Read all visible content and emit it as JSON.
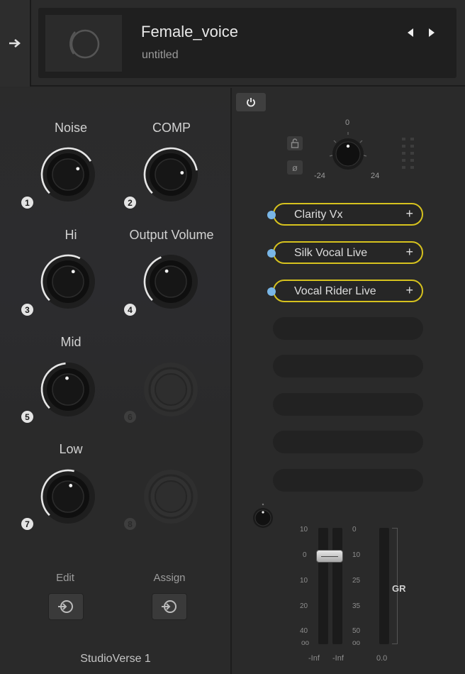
{
  "header": {
    "preset_name": "Female_voice",
    "preset_subtitle": "untitled",
    "side_icon": "arrow-right-icon",
    "prev_icon": "triangle-left-icon",
    "next_icon": "triangle-right-icon"
  },
  "macros": {
    "knobs": [
      {
        "label": "Noise",
        "number": "1",
        "value": 0.72
      },
      {
        "label": "COMP",
        "number": "2",
        "value": 0.8
      },
      {
        "label": "Hi",
        "number": "3",
        "value": 0.6
      },
      {
        "label": "Output Volume",
        "number": "4",
        "value": 0.42
      },
      {
        "label": "Mid",
        "number": "5",
        "value": 0.48
      },
      {
        "label": "",
        "number": "6",
        "value": null
      },
      {
        "label": "Low",
        "number": "7",
        "value": 0.55
      },
      {
        "label": "",
        "number": "8",
        "value": null
      }
    ],
    "edit_label": "Edit",
    "assign_label": "Assign",
    "footer": "StudioVerse 1"
  },
  "fx": {
    "gain_scale": {
      "center": "0",
      "min": "-24",
      "max": "24"
    },
    "plugins": [
      {
        "name": "Clarity Vx",
        "plus": "+"
      },
      {
        "name": "Silk Vocal Live",
        "plus": "+"
      },
      {
        "name": "Vocal Rider Live",
        "plus": "+"
      }
    ],
    "empty_slots": 5,
    "meter": {
      "left_scale": [
        "10",
        "0",
        "10",
        "20",
        "40",
        "oo"
      ],
      "right_scale": [
        "0",
        "10",
        "25",
        "35",
        "50",
        "oo"
      ],
      "bottom_left": "-Inf",
      "bottom_mid": "-Inf",
      "bottom_gr": "0.0",
      "gr_label": "GR"
    }
  },
  "colors": {
    "accent_yellow": "#d6c21e",
    "dot_blue": "#79b6e6",
    "knob_arc": "#e6e6e6"
  }
}
